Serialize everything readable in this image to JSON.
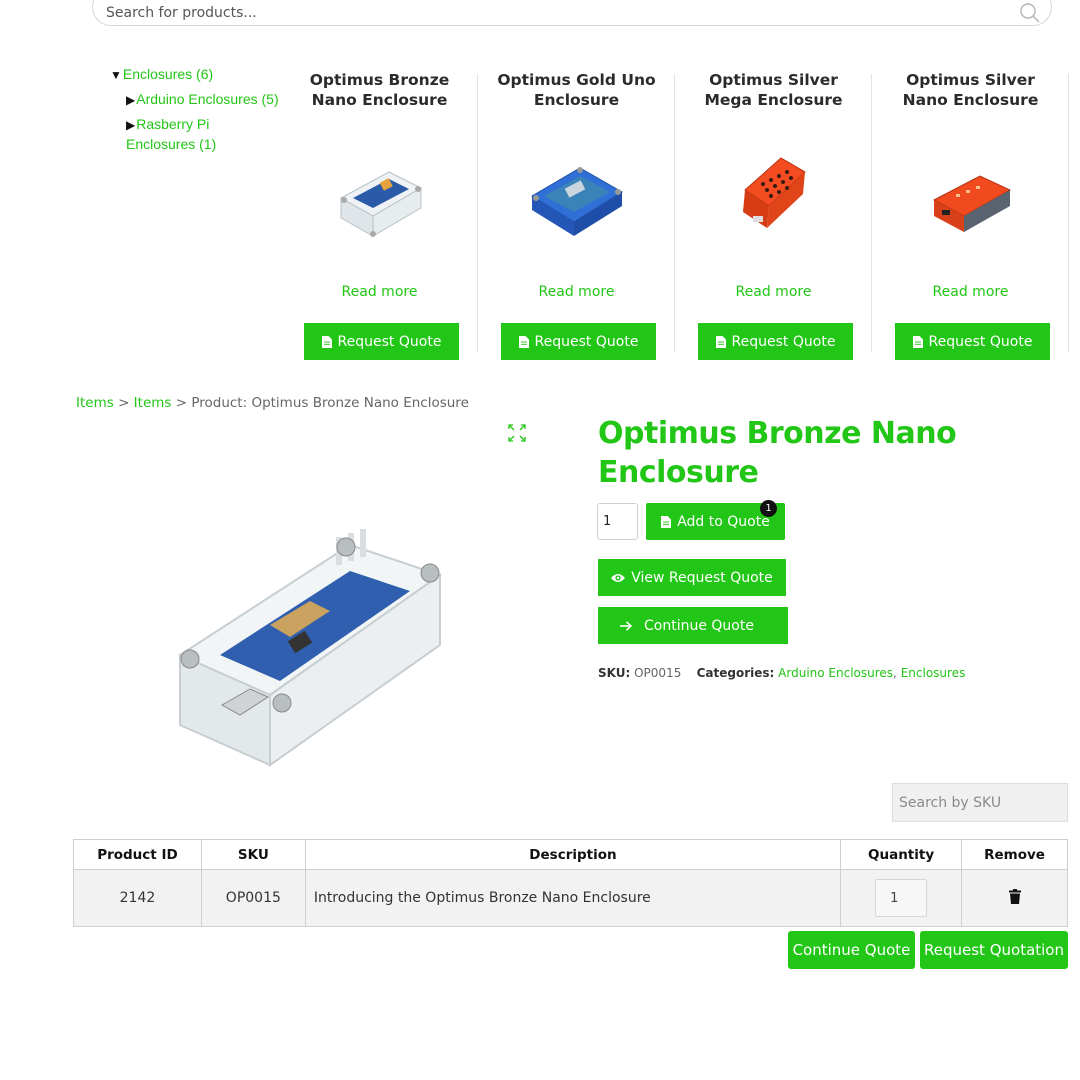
{
  "search": {
    "placeholder": "Search for products..."
  },
  "categories": {
    "root": {
      "label": "Enclosures (6)"
    },
    "children": [
      {
        "label": "Arduino Enclosures (5)"
      },
      {
        "label_line1": "Rasberry Pi",
        "label_line2": "Enclosures (1)"
      }
    ]
  },
  "products": [
    {
      "title_line1": "Optimus Bronze",
      "title_line2": "Nano Enclosure",
      "read_more": "Read more",
      "quote_label": "Request Quote"
    },
    {
      "title_line1": "Optimus Gold Uno",
      "title_line2": "Enclosure",
      "read_more": "Read more",
      "quote_label": "Request Quote"
    },
    {
      "title_line1": "Optimus Silver",
      "title_line2": "Mega Enclosure",
      "read_more": "Read more",
      "quote_label": "Request Quote"
    },
    {
      "title_line1": "Optimus Silver",
      "title_line2": "Nano Enclosure",
      "read_more": "Read more",
      "quote_label": "Request Quote"
    }
  ],
  "breadcrumb": {
    "item1": "Items",
    "sep": ">",
    "item2": "Items",
    "current": "Product: Optimus Bronze Nano Enclosure"
  },
  "product": {
    "title_line1": "Optimus Bronze Nano",
    "title_line2": "Enclosure",
    "quantity": "1",
    "add_to_quote": "Add to Quote",
    "quote_count": "1",
    "view_request_quote": "View Request Quote",
    "continue_quote": "Continue Quote",
    "sku_label": "SKU:",
    "sku": "OP0015",
    "categories_label": "Categories:",
    "category1": "Arduino Enclosures",
    "category_sep": ",",
    "category2": "Enclosures"
  },
  "sku_search": {
    "placeholder": "Search by SKU"
  },
  "table": {
    "headers": [
      "Product ID",
      "SKU",
      "Description",
      "Quantity",
      "Remove"
    ],
    "rows": [
      {
        "product_id": "2142",
        "sku": "OP0015",
        "description": "Introducing the Optimus Bronze Nano Enclosure",
        "quantity": "1"
      }
    ]
  },
  "actions": {
    "continue_quote": "Continue Quote",
    "request_quotation": "Request Quotation"
  },
  "colors": {
    "accent": "#22c616",
    "text": "#333333",
    "badge": "#111111"
  }
}
